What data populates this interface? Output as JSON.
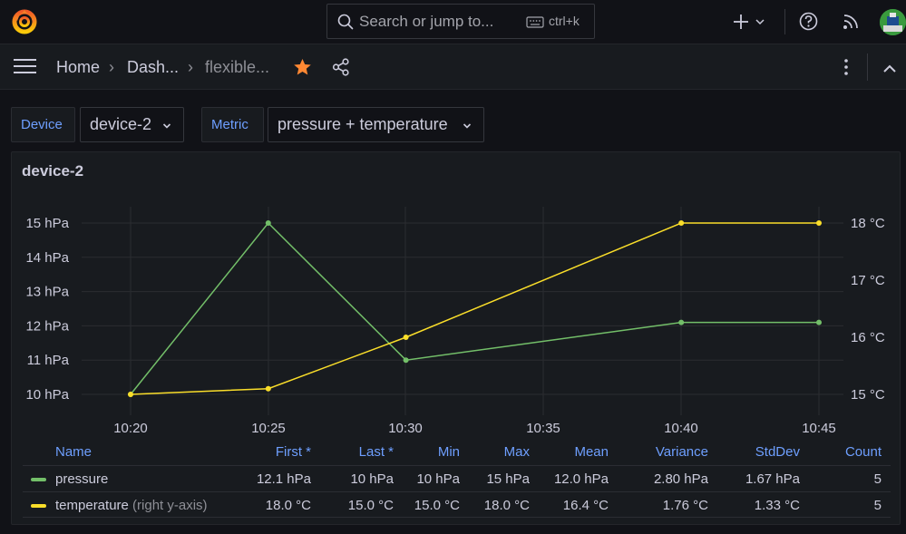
{
  "topbar": {
    "search_placeholder": "Search or jump to...",
    "search_shortcut": "ctrl+k"
  },
  "breadcrumb": {
    "home": "Home",
    "section": "Dash...",
    "current": "flexible..."
  },
  "variables": [
    {
      "label": "Device",
      "value": "device-2"
    },
    {
      "label": "Metric",
      "value": "pressure + temperature"
    }
  ],
  "panel": {
    "title": "device-2"
  },
  "chart_data": {
    "type": "line",
    "x": [
      "10:20",
      "10:25",
      "10:30",
      "10:40",
      "10:45"
    ],
    "x_ticks": [
      "10:20",
      "10:25",
      "10:30",
      "10:35",
      "10:40",
      "10:45"
    ],
    "series": [
      {
        "name": "pressure",
        "color": "#73bf69",
        "axis": "left",
        "values": [
          10,
          15,
          11,
          12.1,
          12.1
        ]
      },
      {
        "name": "temperature",
        "color": "#fade2a",
        "axis": "right",
        "values": [
          15.0,
          15.1,
          16.0,
          18.0,
          18.0
        ]
      }
    ],
    "y_left": {
      "ticks": [
        "10 hPa",
        "11 hPa",
        "12 hPa",
        "13 hPa",
        "14 hPa",
        "15 hPa"
      ],
      "range": [
        10,
        15
      ]
    },
    "y_right": {
      "ticks": [
        "15 °C",
        "16 °C",
        "17 °C",
        "18 °C"
      ],
      "range": [
        15,
        18
      ]
    },
    "grid": true,
    "legend": "table-bottom"
  },
  "legend": {
    "headers": [
      "Name",
      "First *",
      "Last *",
      "Min",
      "Max",
      "Mean",
      "Variance",
      "StdDev",
      "Count"
    ],
    "rows": [
      {
        "name": "pressure",
        "suffix": "",
        "color": "#73bf69",
        "values": [
          "12.1 hPa",
          "10 hPa",
          "10 hPa",
          "15 hPa",
          "12.0 hPa",
          "2.80 hPa",
          "1.67 hPa",
          "5"
        ]
      },
      {
        "name": "temperature",
        "suffix": "(right y-axis)",
        "color": "#fade2a",
        "values": [
          "18.0 °C",
          "15.0 °C",
          "15.0 °C",
          "18.0 °C",
          "16.4 °C",
          "1.76 °C",
          "1.33 °C",
          "5"
        ]
      }
    ]
  },
  "icons": {
    "logo": "grafana-logo-icon",
    "search": "search-icon",
    "keyboard": "keyboard-icon",
    "add": "plus-icon",
    "help": "help-icon",
    "news": "rss-icon",
    "menu": "hamburger-menu-icon",
    "star": "star-icon",
    "share": "share-icon",
    "more": "kebab-menu-icon",
    "collapse": "chevron-up-icon"
  },
  "colors": {
    "accent_blue": "#6e9fff",
    "star": "#ff8833"
  }
}
